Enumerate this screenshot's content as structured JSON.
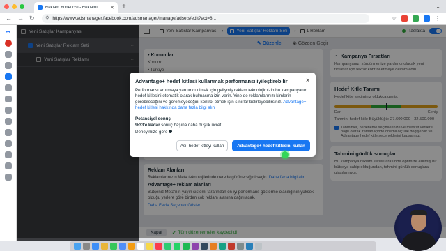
{
  "browser": {
    "tab_title": "Reklam Yöneticisi - Reklamı...",
    "url": "https://www.adsmanager.facebook.com/adsmanager/manage/adsets/edit?act=8...",
    "traffic_colors": [
      "#ff5f57",
      "#febc2e",
      "#28c840"
    ]
  },
  "tree": {
    "items": [
      {
        "label": "Yeni Satışlar Kampanyası"
      },
      {
        "label": "Yeni Satışlar Reklam Seti"
      },
      {
        "label": "Yeni Satışlar Reklamı"
      }
    ]
  },
  "header": {
    "crumbs": [
      "Yeni Satışlar Kampanyası",
      "Yeni Satışlar Reklam Seti",
      "1 Reklam"
    ],
    "draft_label": "Taslakta"
  },
  "subbar": {
    "edit": "Düzenle",
    "review": "Gözden Geçir"
  },
  "content": {
    "konumlar_title": "• Konumlar",
    "konum_label": "Konum:",
    "konum_value": "• Türkiye",
    "placements_title": "Reklam Alanları",
    "placements_text": "Reklamlarınızın Meta teknolojilerinde nerede görüneceğini seçin.",
    "placements_link": "Daha fazla bilgi alın",
    "adv_placements_title": "Advantage+ reklam alanları",
    "adv_placements_text": "Bütçeniz Meta'nın yayın sistemi tarafından en iyi performans gösterme olasılığının yüksek olduğu yerlere göre birden çok reklam alanına dağıtılacak.",
    "more_options": "Daha Fazla Seçenek Göster"
  },
  "side": {
    "opportunity_title": "Kampanya Fırsatları",
    "opportunity_text": "Kampanyanızı sürdürmenize yardımcı olacak yeni fırsatlar için tekrar kontrol etmeye devam edin",
    "audience_title": "Hedef Kitle Tanımı",
    "audience_sub": "Hedef kitle seçiminiz oldukça geniş.",
    "gauge_left": "Dar",
    "gauge_right": "Geniş",
    "audience_size": "Tahmini hedef kitle Büyüklüğü: 27.600.000 - 32.500.000",
    "audience_note": "Tahminler, hedefleme seçimlerinize ve mevcut verilere bağlı olarak zaman içinde önemli ölçüde değişebilir ve Advantage hedef kitle seçeneklerini kapsamaz.",
    "daily_title": "Tahmini günlük sonuçlar",
    "daily_text": "Bu kampanya reklam setleri arasında optimize edilmiş bir bütçeye sahip olduğundan, tahmini günlük sonuçlara ulaşılamıyor."
  },
  "footer": {
    "close": "Kapat",
    "saved": "Tüm düzenlemeler kaydedildi"
  },
  "modal": {
    "title": "Advantage+ hedef kitlesi kullanmak performansı iyileştirebilir",
    "body": "Performansı artırmaya yardımcı olmak için gelişmiş reklam teknolojimizin bu kampanyanın hedef kitlesini otomatik olarak bulmasına izin verin. Yine de reklamlarınızı kimlerin görebileceğini ve göremeyeceğini kontrol etmek için sınırlar belirleyebilirsiniz.",
    "body_link": "Advantage+ hedef kitlesi hakkında daha fazla bilgi alın",
    "perf_title": "Potansiyel sonuç",
    "perf_value": "%33'e kadar",
    "perf_text": "sonuç başına daha düşük ücret",
    "perf_note": "Deneyimize göre",
    "btn_secondary": "Asıl hedef kitleyi kullan",
    "btn_primary": "Advantage+ hedef kitlesini kullan"
  },
  "colors": {
    "accent": "#1877f2",
    "success": "#2eaa3a"
  }
}
